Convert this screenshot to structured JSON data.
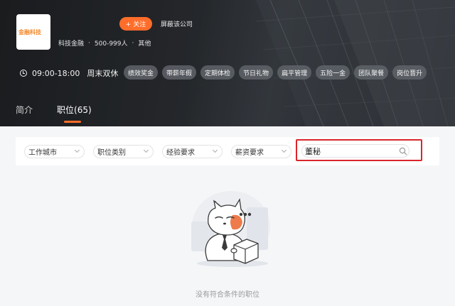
{
  "company": {
    "logo_text": "金融科技",
    "follow_label": "+ 关注",
    "block_label": "屏蔽该公司",
    "industry": "科技金融",
    "size": "500-999人",
    "other": "其他"
  },
  "hours": {
    "time": "09:00-18:00",
    "weekend": "周末双休"
  },
  "tags": [
    "绩效奖金",
    "带薪年假",
    "定期体检",
    "节日礼物",
    "扁平管理",
    "五险一金",
    "团队聚餐",
    "岗位晋升"
  ],
  "tabs": {
    "intro": "简介",
    "jobs": "职位(65)"
  },
  "filters": {
    "city": "工作城市",
    "category": "职位类别",
    "experience": "经验要求",
    "salary": "薪资要求"
  },
  "search": {
    "value": "董秘"
  },
  "empty_state": {
    "message": "没有符合条件的职位"
  },
  "colors": {
    "accent": "#ff6d2a",
    "highlight": "#d9262c"
  }
}
